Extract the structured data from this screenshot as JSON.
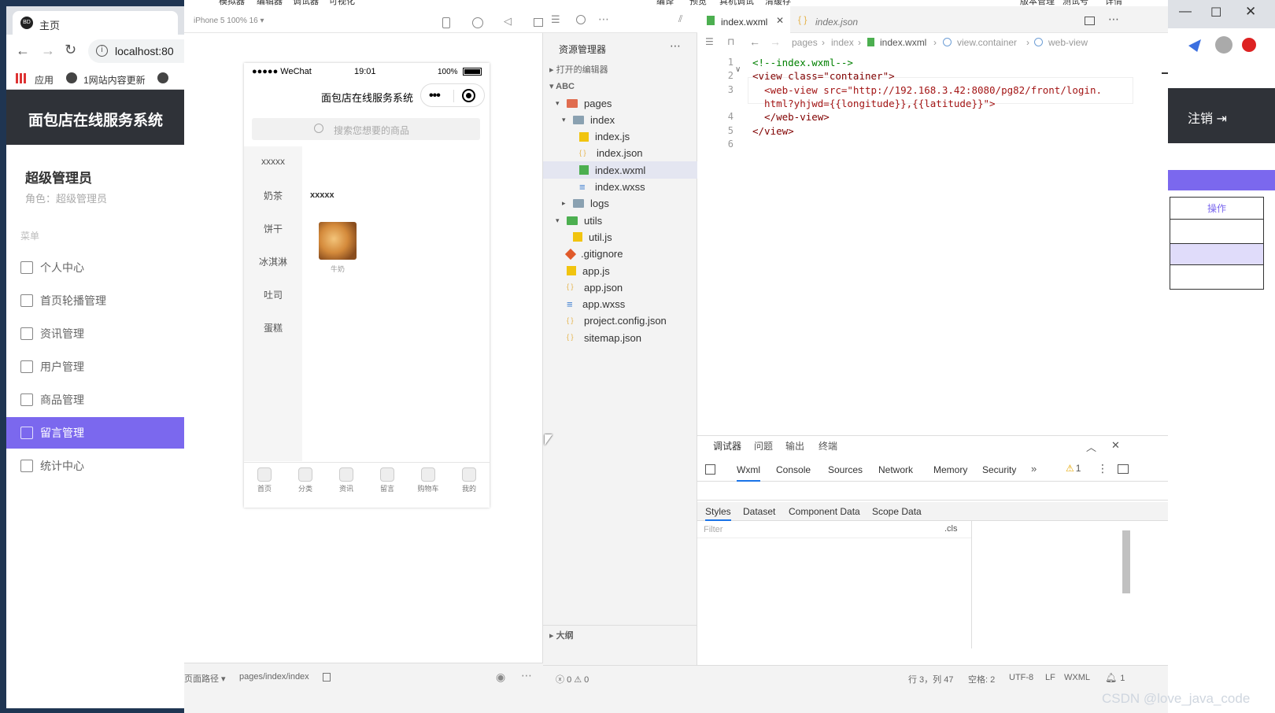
{
  "browser": {
    "tab_title": "主页",
    "url": "localhost:80",
    "bookmarks": [
      "应用",
      "1网站内容更新"
    ]
  },
  "admin": {
    "header_title": "面包店在线服务系统",
    "user_title": "超级管理员",
    "role_text": "角色：超级管理员",
    "menu_label": "菜单",
    "menu": [
      "个人中心",
      "首页轮播管理",
      "资讯管理",
      "用户管理",
      "商品管理",
      "留言管理",
      "统计中心"
    ],
    "active_index": 5,
    "logout_label": "注销",
    "operation_header": "操作"
  },
  "devtool": {
    "menubar": [
      "模拟器",
      "编辑器",
      "调试器",
      "可视化",
      "编译",
      "预览",
      "真机调试",
      "清缓存",
      "版本管理",
      "测试号",
      "详情"
    ],
    "simulator": {
      "device": "iPhone 5 100% 16 ▾",
      "status_carrier": "●●●●● WeChat",
      "status_time": "19:01",
      "status_battery": "100%",
      "nav_title": "面包店在线服务系统",
      "search_placeholder": "搜索您想要的商品",
      "categories": [
        "xxxxx",
        "奶茶",
        "饼干",
        "冰淇淋",
        "吐司",
        "蛋糕"
      ],
      "section_title": "xxxxx",
      "product_name": "牛奶",
      "tabbar": [
        "首页",
        "分类",
        "资讯",
        "留言",
        "购物车",
        "我的"
      ],
      "footer_label": "页面路径 ▾",
      "footer_path": "pages/index/index"
    },
    "explorer": {
      "title": "资源管理器",
      "open_editors": "打开的编辑器",
      "project": "ABC",
      "tree": [
        {
          "name": "pages",
          "depth": 1,
          "type": "folder-open",
          "color": "#e06c4f"
        },
        {
          "name": "index",
          "depth": 2,
          "type": "folder-open",
          "color": "#8aa1b1"
        },
        {
          "name": "index.js",
          "depth": 3,
          "type": "js",
          "color": "#f1c40f"
        },
        {
          "name": "index.json",
          "depth": 3,
          "type": "json",
          "color": "#e5b34b"
        },
        {
          "name": "index.wxml",
          "depth": 3,
          "type": "wxml",
          "color": "#4caf50",
          "selected": true
        },
        {
          "name": "index.wxss",
          "depth": 3,
          "type": "wxss",
          "color": "#3f7fd1"
        },
        {
          "name": "logs",
          "depth": 2,
          "type": "folder",
          "color": "#8aa1b1"
        },
        {
          "name": "utils",
          "depth": 1,
          "type": "folder-open",
          "color": "#4caf50"
        },
        {
          "name": "util.js",
          "depth": 2,
          "type": "js",
          "color": "#f1c40f"
        },
        {
          "name": ".gitignore",
          "depth": 1,
          "type": "git",
          "color": "#e05a2b"
        },
        {
          "name": "app.js",
          "depth": 1,
          "type": "js",
          "color": "#f1c40f"
        },
        {
          "name": "app.json",
          "depth": 1,
          "type": "json",
          "color": "#e5b34b"
        },
        {
          "name": "app.wxss",
          "depth": 1,
          "type": "wxss",
          "color": "#3f7fd1"
        },
        {
          "name": "project.config.json",
          "depth": 1,
          "type": "json",
          "color": "#e5b34b"
        },
        {
          "name": "sitemap.json",
          "depth": 1,
          "type": "json",
          "color": "#e5b34b"
        }
      ],
      "outline": "大纲"
    },
    "editor": {
      "tabs": [
        "index.wxml",
        "index.json"
      ],
      "breadcrumb": [
        "pages",
        "index",
        "index.wxml",
        "view.container",
        "web-view"
      ],
      "lines": [
        {
          "n": "1",
          "text": "<!--index.wxml-->"
        },
        {
          "n": "2",
          "text": "<view class=\"container\">"
        },
        {
          "n": "3",
          "text": "  <web-view src=\"http://192.168.3.42:8080/pg82/front/login."
        },
        {
          "n": "",
          "text": "  html?yhjwd={{longitude}},{{latitude}}\">"
        },
        {
          "n": "4",
          "text": "  </web-view>"
        },
        {
          "n": "5",
          "text": "</view>"
        },
        {
          "n": "6",
          "text": ""
        }
      ]
    },
    "debugger": {
      "top_tabs": [
        "调试器",
        "问题",
        "输出",
        "终端"
      ],
      "panel_tabs": [
        "Wxml",
        "Console",
        "Sources",
        "Network",
        "Memory",
        "Security"
      ],
      "warning_count": "1",
      "sub_tabs": [
        "Styles",
        "Dataset",
        "Component Data",
        "Scope Data"
      ],
      "filter_placeholder": "Filter",
      "cls_label": ".cls"
    },
    "status": {
      "errors": "0",
      "warnings": "0",
      "cursor": "行 3，列 47",
      "spaces": "空格: 2",
      "encoding": "UTF-8",
      "eol": "LF",
      "lang": "WXML",
      "bell_count": "1"
    }
  },
  "watermark": "CSDN @love_java_code"
}
